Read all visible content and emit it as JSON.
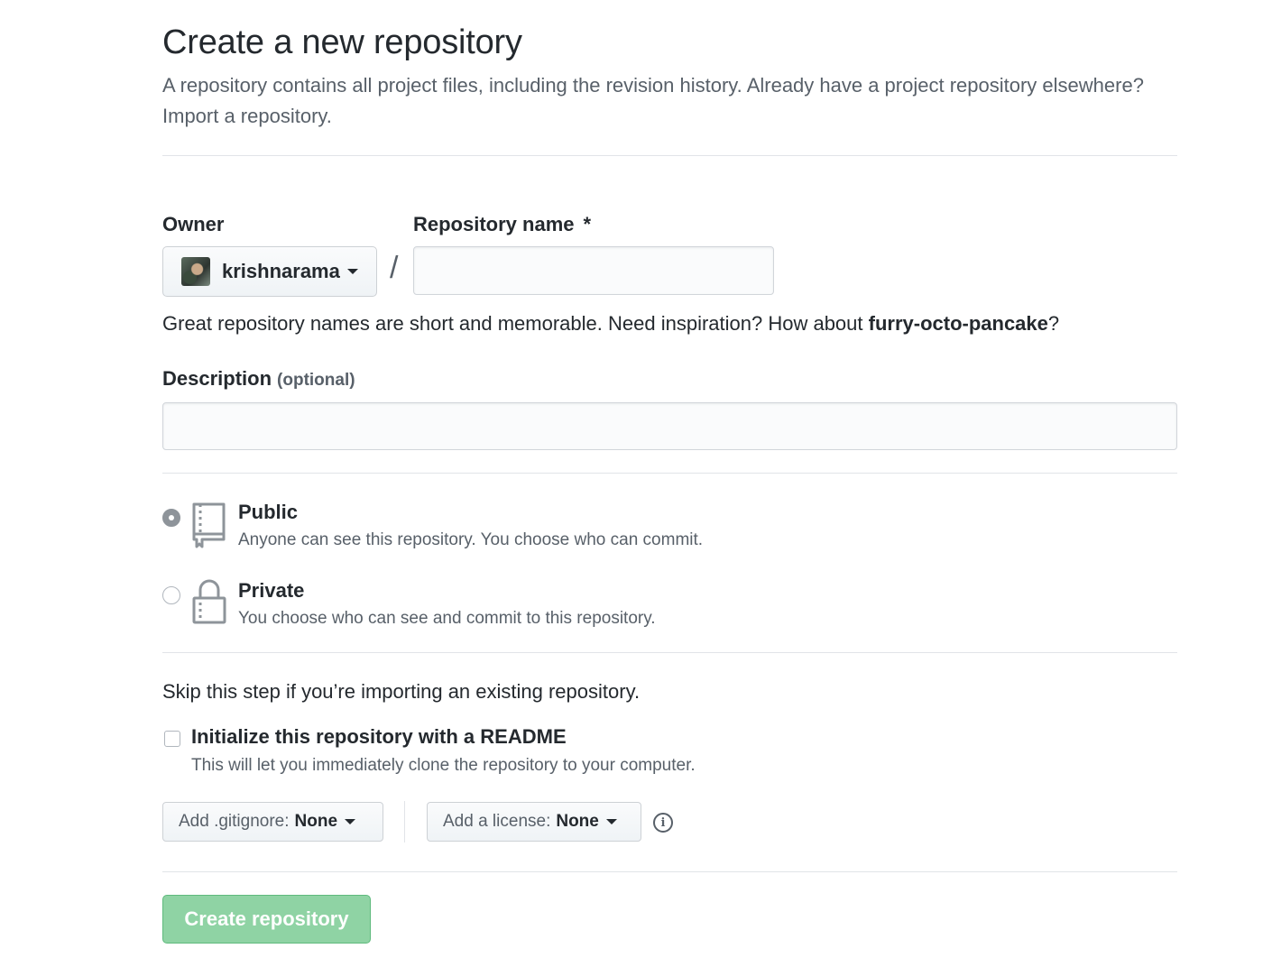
{
  "header": {
    "title": "Create a new repository",
    "subtitle": "A repository contains all project files, including the revision history. Already have a project repository elsewhere?",
    "import_link": "Import a repository."
  },
  "owner": {
    "label": "Owner",
    "value": "krishnarama"
  },
  "separator": "/",
  "repo_name": {
    "label": "Repository name",
    "required_mark": "*",
    "value": "",
    "hint_prefix": "Great repository names are short and memorable. Need inspiration? How about ",
    "suggestion": "furry-octo-pancake",
    "hint_suffix": "?"
  },
  "description": {
    "label": "Description",
    "optional": "(optional)",
    "value": ""
  },
  "visibility": {
    "selected": "public",
    "options": [
      {
        "key": "public",
        "title": "Public",
        "desc": "Anyone can see this repository. You choose who can commit.",
        "icon": "repo-book-icon"
      },
      {
        "key": "private",
        "title": "Private",
        "desc": "You choose who can see and commit to this repository.",
        "icon": "lock-icon"
      }
    ]
  },
  "init": {
    "skip_text": "Skip this step if you’re importing an existing repository.",
    "checkbox_label": "Initialize this repository with a README",
    "checkbox_desc": "This will let you immediately clone the repository to your computer.",
    "checked": false
  },
  "gitignore": {
    "prefix": "Add .gitignore:",
    "value": "None"
  },
  "license": {
    "prefix": "Add a license:",
    "value": "None"
  },
  "submit": {
    "label": "Create repository",
    "disabled": true
  },
  "colors": {
    "submit_bg": "#8fd3a4",
    "text": "#24292e",
    "muted": "#586069",
    "border": "#e1e4e8"
  }
}
